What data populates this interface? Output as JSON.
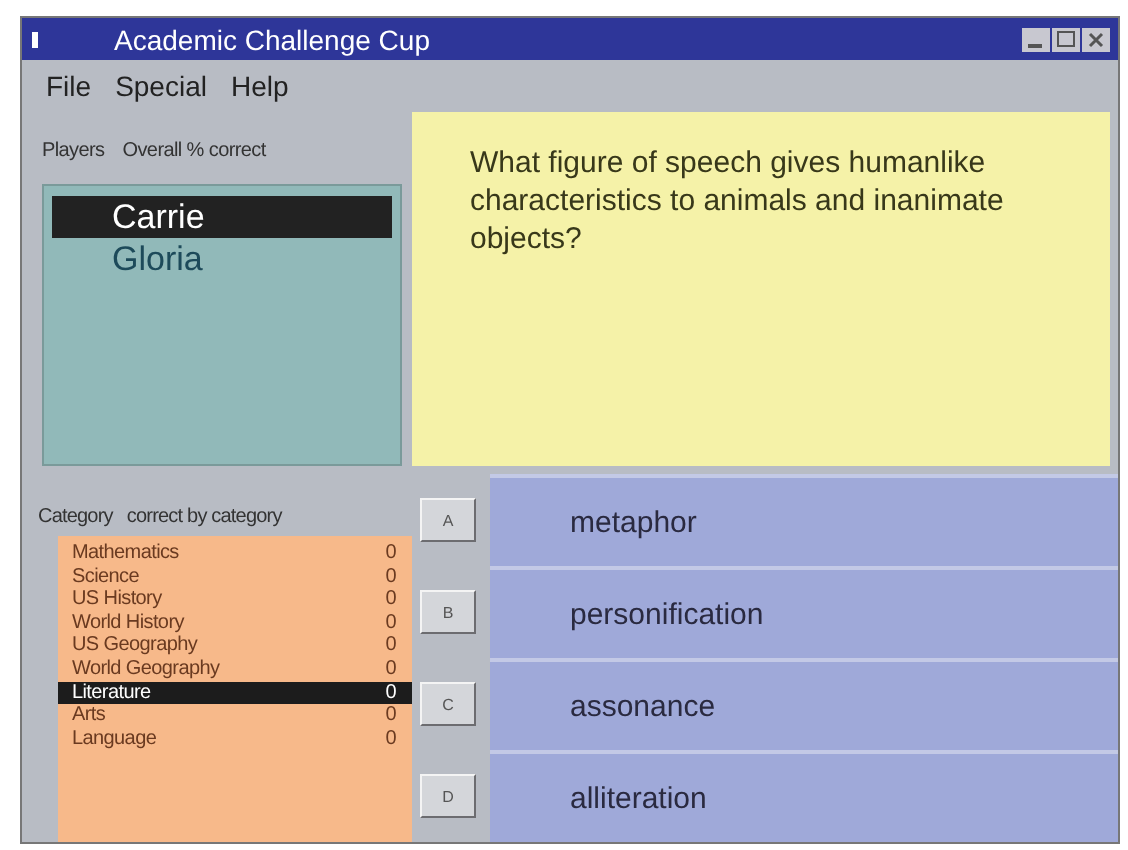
{
  "window": {
    "title": "Academic Challenge Cup"
  },
  "menu": [
    "File",
    "Special",
    "Help"
  ],
  "players": {
    "columns": [
      "Players",
      "Overall % correct"
    ],
    "items": [
      {
        "name": "Carrie",
        "selected": true
      },
      {
        "name": "Gloria",
        "selected": false
      }
    ]
  },
  "question": "What figure of speech gives humanlike characteristics to animals and inanimate objects?",
  "categories": {
    "columns": [
      "Category",
      "correct by category"
    ],
    "items": [
      {
        "name": "Mathematics",
        "score": "0",
        "selected": false
      },
      {
        "name": "Science",
        "score": "0",
        "selected": false
      },
      {
        "name": "US History",
        "score": "0",
        "selected": false
      },
      {
        "name": "World History",
        "score": "0",
        "selected": false
      },
      {
        "name": "US Geography",
        "score": "0",
        "selected": false
      },
      {
        "name": "World Geography",
        "score": "0",
        "selected": false
      },
      {
        "name": "Literature",
        "score": "0",
        "selected": true
      },
      {
        "name": "Arts",
        "score": "0",
        "selected": false
      },
      {
        "name": "Language",
        "score": "0",
        "selected": false
      }
    ]
  },
  "answers": [
    {
      "letter": "A",
      "text": "metaphor"
    },
    {
      "letter": "B",
      "text": "personification"
    },
    {
      "letter": "C",
      "text": "assonance"
    },
    {
      "letter": "D",
      "text": "alliteration"
    }
  ]
}
